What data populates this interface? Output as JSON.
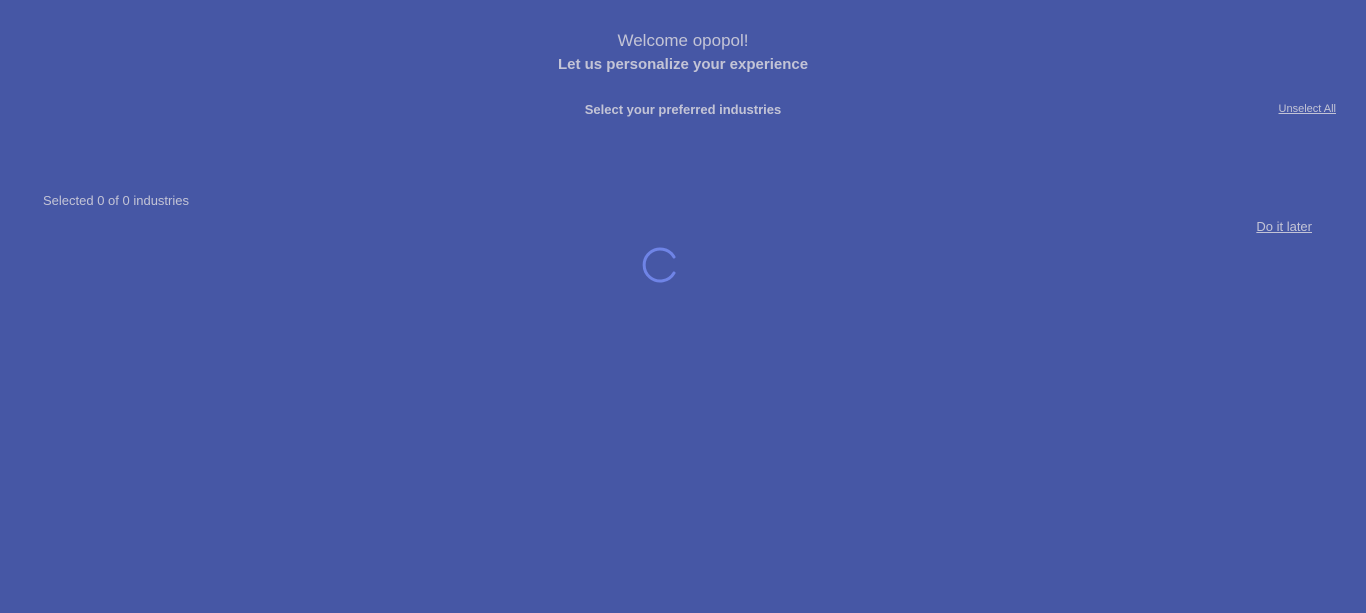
{
  "header": {
    "welcome": "Welcome opopol!",
    "subtitle": "Let us personalize your experience"
  },
  "industries": {
    "title": "Select your preferred industries",
    "unselect_all_label": "Unselect All",
    "selected_text": "Selected 0 of 0 industries",
    "selected_count": 0,
    "total_count": 0
  },
  "actions": {
    "do_it_later_label": "Do it later"
  },
  "loading": {
    "icon": "loading-spinner-icon",
    "color": "#6f84e6"
  },
  "colors": {
    "background": "#4657a5",
    "text": "#c3c4d6"
  }
}
